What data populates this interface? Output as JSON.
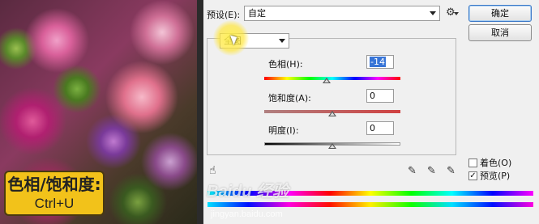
{
  "caption": {
    "line1": "色相/饱和度:",
    "line2": "Ctrl+U"
  },
  "dialog": {
    "preset_label": "预设(E):",
    "preset_value": "自定",
    "ok_label": "确定",
    "cancel_label": "取消",
    "channel_value": "全图",
    "hue": {
      "label": "色相(H):",
      "value": "-14",
      "level": -14,
      "range": [
        -180,
        180
      ]
    },
    "saturation": {
      "label": "饱和度(A):",
      "value": "0",
      "level": 0,
      "range": [
        -100,
        100
      ]
    },
    "lightness": {
      "label": "明度(I):",
      "value": "0",
      "level": 0,
      "range": [
        -100,
        100
      ]
    },
    "colorize": {
      "label": "着色(O)",
      "checked": false
    },
    "preview": {
      "label": "预览(P)",
      "checked": true
    }
  },
  "watermark": {
    "main": "Baidu 经验",
    "sub": "jingyan.baidu.com"
  }
}
